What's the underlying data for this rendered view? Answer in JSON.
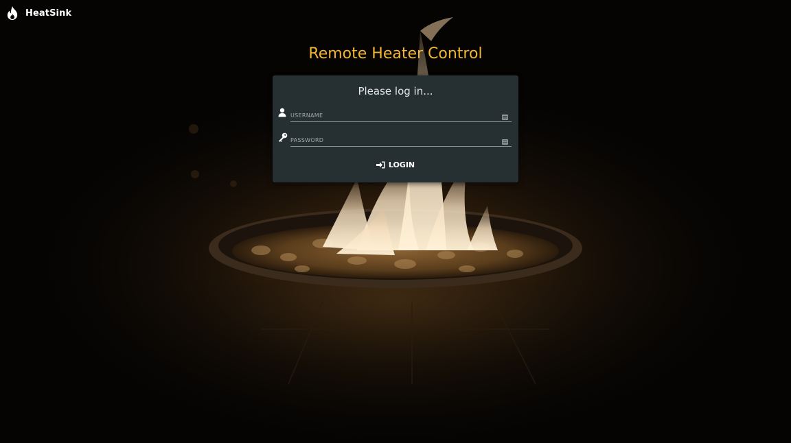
{
  "app": {
    "name": "HeatSink",
    "logo_icon": "flame-icon"
  },
  "page": {
    "title": "Remote Heater Control"
  },
  "login_card": {
    "heading": "Please log in...",
    "username": {
      "placeholder": "USERNAME",
      "value": "",
      "icon": "user-icon"
    },
    "password": {
      "placeholder": "PASSWORD",
      "value": "",
      "icon": "key-icon"
    },
    "login_button": {
      "label": "LOGIN",
      "icon": "sign-in-icon"
    }
  },
  "colors": {
    "accent": "#f2b533",
    "card": "#263033",
    "background": "#050403"
  }
}
